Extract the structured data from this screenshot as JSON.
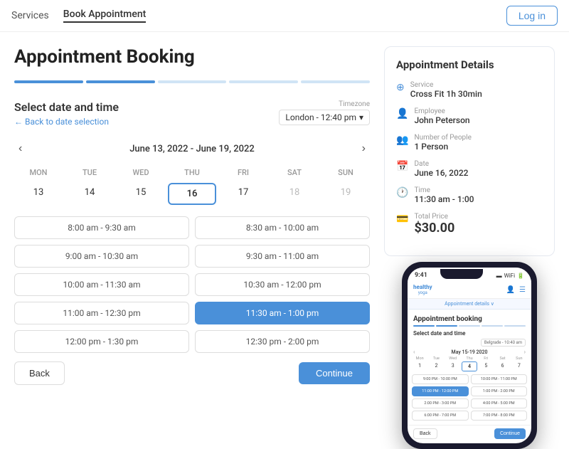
{
  "nav": {
    "services_label": "Services",
    "book_label": "Book Appointment",
    "login_label": "Log in"
  },
  "page": {
    "title": "Appointment Booking",
    "progress": [
      {
        "active": true
      },
      {
        "active": true
      },
      {
        "active": false
      },
      {
        "active": false
      },
      {
        "active": false
      }
    ]
  },
  "calendar": {
    "section_title": "Select date and time",
    "back_link": "← Back to date selection",
    "timezone_label": "Timezone",
    "timezone_value": "London - 12:40 pm",
    "week_title": "June 13, 2022 - June 19, 2022",
    "days": [
      "MON",
      "TUE",
      "WED",
      "THU",
      "FRI",
      "SAT",
      "SUN"
    ],
    "dates": [
      "13",
      "14",
      "15",
      "16",
      "17",
      "18",
      "19"
    ],
    "selected_date_index": 3
  },
  "time_slots": [
    {
      "col": 0,
      "label": "8:00 am - 9:30 am"
    },
    {
      "col": 1,
      "label": "8:30 am - 10:00 am"
    },
    {
      "col": 0,
      "label": "9:00 am - 10:30 am"
    },
    {
      "col": 1,
      "label": "9:30 am - 11:00 am"
    },
    {
      "col": 0,
      "label": "10:00 am - 11:30 am"
    },
    {
      "col": 1,
      "label": "10:30 am - 12:00 pm"
    },
    {
      "col": 0,
      "label": "11:00 am - 12:30 pm"
    },
    {
      "col": 1,
      "label": "11:30 am - 1:00 pm"
    },
    {
      "col": 0,
      "label": "12:00 pm - 1:30 pm"
    },
    {
      "col": 1,
      "label": "12:30 pm - 2:00 pm"
    }
  ],
  "selected_slot": "11:30 am - 1:00 pm",
  "buttons": {
    "back_label": "Back",
    "continue_label": "Continue"
  },
  "details": {
    "title": "Appointment Details",
    "service_label": "Service",
    "service_value": "Cross Fit 1h 30min",
    "employee_label": "Employee",
    "employee_value": "John Peterson",
    "people_label": "Number of People",
    "people_value": "1 Person",
    "date_label": "Date",
    "date_value": "June 16, 2022",
    "time_label": "Time",
    "time_value": "11:30 am - 1:00",
    "price_label": "Total Price",
    "price_value": "$30.00"
  },
  "phone": {
    "time": "9:41",
    "app_title_top": "healthy",
    "app_title_bottom": "yoga",
    "nav_label": "Appointment details ∨",
    "section_title": "Appointment booking",
    "sub_title": "Select date and time",
    "timezone_label": "Belgrade - 10:40 am",
    "cal_prev": "‹",
    "cal_next": "›",
    "cal_title": "May 15-19 2020",
    "days": [
      "Mon",
      "Tue",
      "Wed",
      "Thu",
      "Fri",
      "Sat",
      "Sun"
    ],
    "dates": [
      "1",
      "2",
      "3",
      "4",
      "5",
      "6",
      "7"
    ],
    "selected_phone_date": "4",
    "slots_phone": [
      {
        "label": "9:00 PM - 10:00 PM",
        "sel": false
      },
      {
        "label": "10:00 PM - 11:00 PM",
        "sel": false
      },
      {
        "label": "11:00 PM - 12:00 PM",
        "sel": true
      },
      {
        "label": "1:00 PM - 2:00 PM",
        "sel": false
      },
      {
        "label": "2:00 PM - 3:00 PM",
        "sel": false
      },
      {
        "label": "4:00 PM - 5:00 PM",
        "sel": false
      },
      {
        "label": "6:00 PM - 7:00 PM",
        "sel": false
      },
      {
        "label": "7:00 PM - 8:00 PM",
        "sel": false
      }
    ],
    "btn_back": "Back",
    "btn_continue": "Continue"
  }
}
